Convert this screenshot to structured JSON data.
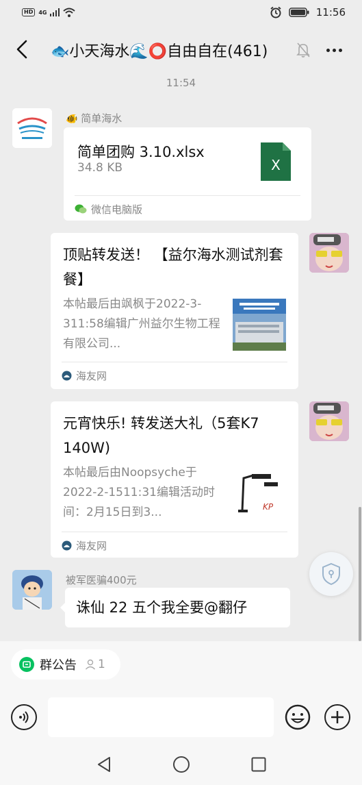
{
  "status_bar": {
    "left_badge": "HD",
    "network": "4G",
    "time": "11:56"
  },
  "header": {
    "title": "🐟小天海水🌊⭕自由自在(461)"
  },
  "timestamp": "11:54",
  "messages": [
    {
      "sender": "简单海水",
      "type": "file",
      "file_name": "简单团购 3.10.xlsx",
      "file_size": "34.8 KB",
      "file_icon_text": "X",
      "source": "微信电脑版"
    },
    {
      "type": "link",
      "title": "顶贴转发送！ 【益尔海水测试剂套餐】",
      "desc": "本帖最后由飒枫于2022-3-311:58编辑广州益尔生物工程有限公司...",
      "source": "海友网"
    },
    {
      "type": "link",
      "title": "元宵快乐! 转发送大礼（5套K7 140W)",
      "desc": "本帖最后由Noopsyche于2022-2-1511:31编辑活动时间：2月15日到3...",
      "source": "海友网"
    },
    {
      "sender": "被军医骗400元",
      "type": "text",
      "text": "诛仙 22 五个我全要@翻仔"
    }
  ],
  "bottom": {
    "notice_label": "群公告",
    "notice_count": "1",
    "input_placeholder": ""
  },
  "icons": {
    "back": "chevron-left-icon",
    "mute": "bell-off-icon",
    "more": "more-dots-icon",
    "voice": "voice-icon",
    "emoji": "emoji-icon",
    "plus": "plus-icon"
  },
  "colors": {
    "background": "#ededed",
    "excel_green": "#1f7244",
    "wechat_green": "#07c160"
  }
}
